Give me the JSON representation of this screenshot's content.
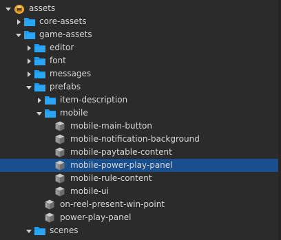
{
  "tree": {
    "items": [
      {
        "label": "assets",
        "depth": 0,
        "expandable": true,
        "expanded": true,
        "icon": "db-icon",
        "selected": false
      },
      {
        "label": "core-assets",
        "depth": 1,
        "expandable": true,
        "expanded": false,
        "icon": "folder-icon",
        "selected": false
      },
      {
        "label": "game-assets",
        "depth": 1,
        "expandable": true,
        "expanded": true,
        "icon": "folder-icon",
        "selected": false
      },
      {
        "label": "editor",
        "depth": 2,
        "expandable": true,
        "expanded": false,
        "icon": "folder-icon",
        "selected": false
      },
      {
        "label": "font",
        "depth": 2,
        "expandable": true,
        "expanded": false,
        "icon": "folder-icon",
        "selected": false
      },
      {
        "label": "messages",
        "depth": 2,
        "expandable": true,
        "expanded": false,
        "icon": "folder-icon",
        "selected": false
      },
      {
        "label": "prefabs",
        "depth": 2,
        "expandable": true,
        "expanded": true,
        "icon": "folder-icon",
        "selected": false
      },
      {
        "label": "item-description",
        "depth": 3,
        "expandable": true,
        "expanded": false,
        "icon": "folder-icon",
        "selected": false
      },
      {
        "label": "mobile",
        "depth": 3,
        "expandable": true,
        "expanded": true,
        "icon": "folder-icon",
        "selected": false
      },
      {
        "label": "mobile-main-button",
        "depth": 4,
        "expandable": false,
        "expanded": false,
        "icon": "prefab-icon",
        "selected": false
      },
      {
        "label": "mobile-notification-background",
        "depth": 4,
        "expandable": false,
        "expanded": false,
        "icon": "prefab-icon",
        "selected": false
      },
      {
        "label": "mobile-paytable-content",
        "depth": 4,
        "expandable": false,
        "expanded": false,
        "icon": "prefab-icon",
        "selected": false
      },
      {
        "label": "mobile-power-play-panel",
        "depth": 4,
        "expandable": false,
        "expanded": false,
        "icon": "prefab-icon",
        "selected": true
      },
      {
        "label": "mobile-rule-content",
        "depth": 4,
        "expandable": false,
        "expanded": false,
        "icon": "prefab-icon",
        "selected": false
      },
      {
        "label": "mobile-ui",
        "depth": 4,
        "expandable": false,
        "expanded": false,
        "icon": "prefab-icon",
        "selected": false
      },
      {
        "label": "on-reel-present-win-point",
        "depth": 3,
        "expandable": false,
        "expanded": false,
        "icon": "prefab-icon",
        "selected": false
      },
      {
        "label": "power-play-panel",
        "depth": 3,
        "expandable": false,
        "expanded": false,
        "icon": "prefab-icon",
        "selected": false
      },
      {
        "label": "scenes",
        "depth": 2,
        "expandable": true,
        "expanded": true,
        "icon": "folder-icon",
        "selected": false
      }
    ]
  },
  "colors": {
    "background": "#2b2b2b",
    "selection": "#1a4f8f",
    "text": "#d6d6d6",
    "folder": "#1e9bf0",
    "arrow": "#cfcfcf",
    "db": "#f0a830",
    "prefab": "#9a9a9a"
  }
}
